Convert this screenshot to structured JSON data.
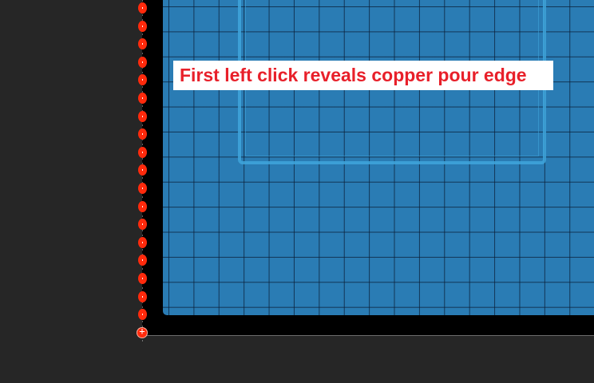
{
  "editor": {
    "colors": {
      "workspace_background": "#262626",
      "board_background": "#000000",
      "copper_pour": "#2a7cb4",
      "copper_outline": "#40a6dc",
      "pad": "#ff2a0c",
      "callout_background": "#ffffff",
      "callout_text": "#e8202a"
    },
    "pads": {
      "count": 18,
      "icon": "pad-circle"
    }
  },
  "callout": {
    "text": "First left click reveals copper pour edge"
  }
}
